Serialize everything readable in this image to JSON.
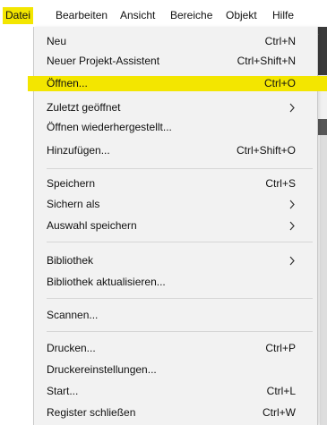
{
  "menubar": {
    "items": [
      {
        "label": "Datei",
        "active": true
      },
      {
        "label": "Bearbeiten",
        "active": false
      },
      {
        "label": "Ansicht",
        "active": false
      },
      {
        "label": "Bereiche",
        "active": false
      },
      {
        "label": "Objekt",
        "active": false
      },
      {
        "label": "Hilfe",
        "active": false
      }
    ]
  },
  "colors": {
    "highlight": "#f3e600",
    "menu_background": "#f2f2f2"
  },
  "menu": {
    "items": [
      {
        "label": "Neu",
        "shortcut": "Ctrl+N"
      },
      {
        "label": "Neuer Projekt-Assistent",
        "shortcut": "Ctrl+Shift+N"
      },
      {
        "label": "Öffnen...",
        "shortcut": "Ctrl+O",
        "highlighted": true
      },
      {
        "label": "Zuletzt geöffnet",
        "submenu": true,
        "submenu_icon": "chevron-right-icon"
      },
      {
        "label": "Öffnen wiederhergestellt..."
      },
      {
        "label": "Hinzufügen...",
        "shortcut": "Ctrl+Shift+O"
      },
      {
        "label": "Speichern",
        "shortcut": "Ctrl+S"
      },
      {
        "label": "Sichern als",
        "submenu": true,
        "submenu_icon": "chevron-right-icon"
      },
      {
        "label": "Auswahl speichern",
        "submenu": true,
        "submenu_icon": "chevron-right-icon"
      },
      {
        "label": "Bibliothek",
        "submenu": true,
        "submenu_icon": "chevron-right-icon"
      },
      {
        "label": "Bibliothek aktualisieren..."
      },
      {
        "label": "Scannen..."
      },
      {
        "label": "Drucken...",
        "shortcut": "Ctrl+P"
      },
      {
        "label": "Druckereinstellungen..."
      },
      {
        "label": "Start...",
        "shortcut": "Ctrl+L"
      },
      {
        "label": "Register schließen",
        "shortcut": "Ctrl+W"
      }
    ]
  }
}
